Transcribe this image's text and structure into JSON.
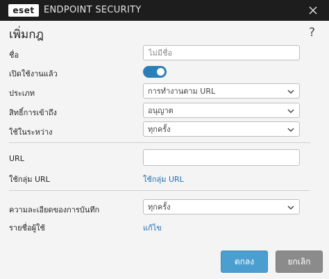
{
  "titlebar": {
    "logo_text": "eset",
    "app_name": "ENDPOINT SECURITY",
    "close_glyph": "✕"
  },
  "dialog": {
    "title": "เพิ่มกฎ",
    "help": "?"
  },
  "form": {
    "name": {
      "label": "ชื่อ",
      "placeholder": "ไม่มีชื่อ"
    },
    "enabled": {
      "label": "เปิดใช้งานแล้ว",
      "value": true
    },
    "type": {
      "label": "ประเภท",
      "value": "การทำงานตาม URL"
    },
    "access": {
      "label": "สิทธิ์การเข้าถึง",
      "value": "อนุญาต"
    },
    "schedule": {
      "label": "ใช้ในระหว่าง",
      "value": "ทุกครั้ง"
    },
    "url": {
      "label": "URL",
      "value": ""
    },
    "url_group": {
      "label": "ใช้กลุ่ม URL",
      "link": "ใช้กลุ่ม URL"
    },
    "log_severity": {
      "label": "ความละเอียดของการบันทึก",
      "value": "ทุกครั้ง"
    },
    "user_list": {
      "label": "รายชื่อผู้ใช้",
      "link": "แก้ไข"
    }
  },
  "buttons": {
    "ok": "ตกลง",
    "cancel": "ยกเลิก"
  },
  "colors": {
    "accent": "#2b7fb8",
    "link": "#1f6fb0",
    "titlebar": "#1d1d1d"
  }
}
